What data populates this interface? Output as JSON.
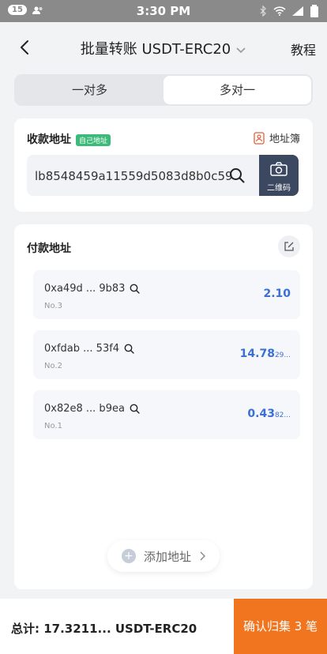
{
  "status_bar": {
    "badge": "15",
    "time": "3:30 PM"
  },
  "nav": {
    "title": "批量转账 USDT-ERC20",
    "right_label": "教程"
  },
  "tabs": [
    {
      "label": "一对多",
      "active": false
    },
    {
      "label": "多对一",
      "active": true
    }
  ],
  "receive": {
    "title": "收款地址",
    "tag": "自己地址",
    "address_book_label": "地址簿",
    "address": "lb8548459a11559d5083d8b0c59",
    "qr_label": "二维码"
  },
  "pay": {
    "title": "付款地址",
    "items": [
      {
        "address": "0xa49d ... 9b83",
        "no": "No.3",
        "amount": "2.10",
        "amount_suffix": ""
      },
      {
        "address": "0xfdab ... 53f4",
        "no": "No.2",
        "amount": "14.78",
        "amount_suffix": "29..."
      },
      {
        "address": "0x82e8 ... b9ea",
        "no": "No.1",
        "amount": "0.43",
        "amount_suffix": "82..."
      }
    ],
    "add_label": "添加地址"
  },
  "bottom": {
    "total_text": "总计: 17.3211... USDT-ERC20",
    "confirm_label": "确认归集 3 笔"
  },
  "colors": {
    "accent_orange": "#f1741f",
    "amount_blue": "#3a6fd4",
    "tag_green": "#3cba7a",
    "qr_dark": "#3c4760"
  }
}
